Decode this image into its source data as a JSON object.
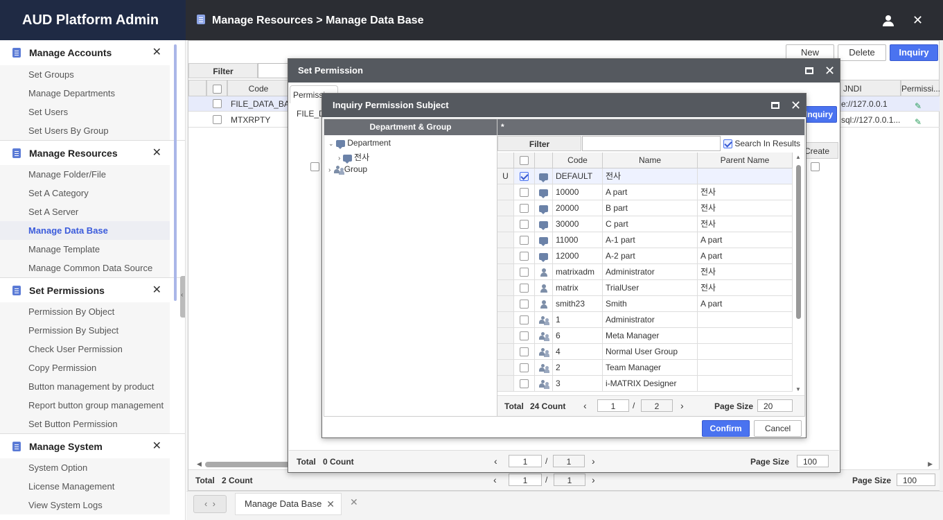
{
  "app": {
    "title": "AUD Platform Admin"
  },
  "header": {
    "breadcrumb": "Manage Resources > Manage Data Base"
  },
  "sidebar": {
    "sections": [
      {
        "title": "Manage Accounts",
        "items": [
          "Set Groups",
          "Manage Departments",
          "Set Users",
          "Set Users By Group"
        ]
      },
      {
        "title": "Manage Resources",
        "items": [
          "Manage Folder/File",
          "Set A Category",
          "Set A Server",
          "Manage Data Base",
          "Manage Template",
          "Manage Common Data Source"
        ]
      },
      {
        "title": "Set Permissions",
        "items": [
          "Permission By Object",
          "Permission By Subject",
          "Check User Permission",
          "Copy Permission",
          "Button management by product",
          "Report button group management",
          "Set Button Permission"
        ]
      },
      {
        "title": "Manage System",
        "items": [
          "System Option",
          "License Management",
          "View System Logs"
        ]
      }
    ]
  },
  "main": {
    "buttons": {
      "new": "New",
      "delete": "Delete",
      "inquiry": "Inquiry"
    },
    "filter_label": "Filter",
    "columns": {
      "code": "Code",
      "jndi": "JNDI",
      "permission": "Permissi..."
    },
    "rows": [
      {
        "code": "FILE_DATA_BAS",
        "jndi": "e://127.0.0.1"
      },
      {
        "code": "MTXRPTY",
        "jndi": "sql://127.0.0.1..."
      }
    ],
    "total_label": "Total",
    "total_count": "2 Count",
    "page": "1",
    "pages": "1",
    "page_size_label": "Page Size",
    "page_size": "100",
    "tab": "Manage Data Base"
  },
  "set_permission": {
    "title": "Set Permission",
    "tab": "Permissi",
    "code_prefix": "FILE_D",
    "inquiry": "Inquiry",
    "create": "Create",
    "total_label": "Total",
    "total_count": "0 Count",
    "page": "1",
    "pages": "1",
    "page_size_label": "Page Size",
    "page_size": "100"
  },
  "inquiry_dialog": {
    "title": "Inquiry Permission Subject",
    "tree_header": "Department & Group",
    "right_header": "*",
    "filter_label": "Filter",
    "search_in_results": "Search In Results",
    "tree": {
      "department": "Department",
      "child": "전사",
      "group": "Group"
    },
    "columns": {
      "code": "Code",
      "name": "Name",
      "parent": "Parent Name"
    },
    "rows": [
      {
        "status": "U",
        "checked": true,
        "icon": "chat",
        "code": "DEFAULT",
        "name": "전사",
        "parent": ""
      },
      {
        "status": "",
        "checked": false,
        "icon": "chat",
        "code": "10000",
        "name": "A part",
        "parent": "전사"
      },
      {
        "status": "",
        "checked": false,
        "icon": "chat",
        "code": "20000",
        "name": "B part",
        "parent": "전사"
      },
      {
        "status": "",
        "checked": false,
        "icon": "chat",
        "code": "30000",
        "name": "C part",
        "parent": "전사"
      },
      {
        "status": "",
        "checked": false,
        "icon": "chat",
        "code": "11000",
        "name": "A-1 part",
        "parent": "A part"
      },
      {
        "status": "",
        "checked": false,
        "icon": "chat",
        "code": "12000",
        "name": "A-2 part",
        "parent": "A part"
      },
      {
        "status": "",
        "checked": false,
        "icon": "user",
        "code": "matrixadm",
        "name": "Administrator",
        "parent": "전사"
      },
      {
        "status": "",
        "checked": false,
        "icon": "user",
        "code": "matrix",
        "name": "TrialUser",
        "parent": "전사"
      },
      {
        "status": "",
        "checked": false,
        "icon": "user",
        "code": "smith23",
        "name": "Smith",
        "parent": "A part"
      },
      {
        "status": "",
        "checked": false,
        "icon": "group",
        "code": "1",
        "name": "Administrator",
        "parent": ""
      },
      {
        "status": "",
        "checked": false,
        "icon": "group",
        "code": "6",
        "name": "Meta Manager",
        "parent": ""
      },
      {
        "status": "",
        "checked": false,
        "icon": "group",
        "code": "4",
        "name": "Normal User Group",
        "parent": ""
      },
      {
        "status": "",
        "checked": false,
        "icon": "group",
        "code": "2",
        "name": "Team Manager",
        "parent": ""
      },
      {
        "status": "",
        "checked": false,
        "icon": "group",
        "code": "3",
        "name": "i-MATRIX Designer",
        "parent": ""
      }
    ],
    "total_label": "Total",
    "total_count": "24 Count",
    "page": "1",
    "pages": "2",
    "page_size_label": "Page Size",
    "page_size": "20",
    "confirm": "Confirm",
    "cancel": "Cancel"
  }
}
